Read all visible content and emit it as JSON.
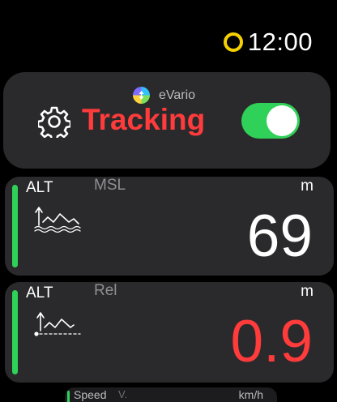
{
  "status_bar": {
    "time": "12:00",
    "indicator_color": "#f5d000"
  },
  "tracking_card": {
    "app_name": "eVario",
    "app_icon": "evario-logo-icon",
    "settings_icon": "gear-icon",
    "label": "Tracking",
    "label_color": "#ff3b3b",
    "toggle_on": true,
    "toggle_color": "#30d158"
  },
  "metrics": [
    {
      "type": "ALT",
      "subtype": "MSL",
      "unit": "m",
      "value": "69",
      "value_color": "#ffffff",
      "icon": "altitude-msl-icon",
      "bar_color": "#30d158"
    },
    {
      "type": "ALT",
      "subtype": "Rel",
      "unit": "m",
      "value": "0.9",
      "value_color": "#ff3b3b",
      "icon": "altitude-relative-icon",
      "bar_color": "#30d158"
    }
  ],
  "speed_card": {
    "label": "Speed",
    "subtype": "V.",
    "unit": "km/h"
  }
}
